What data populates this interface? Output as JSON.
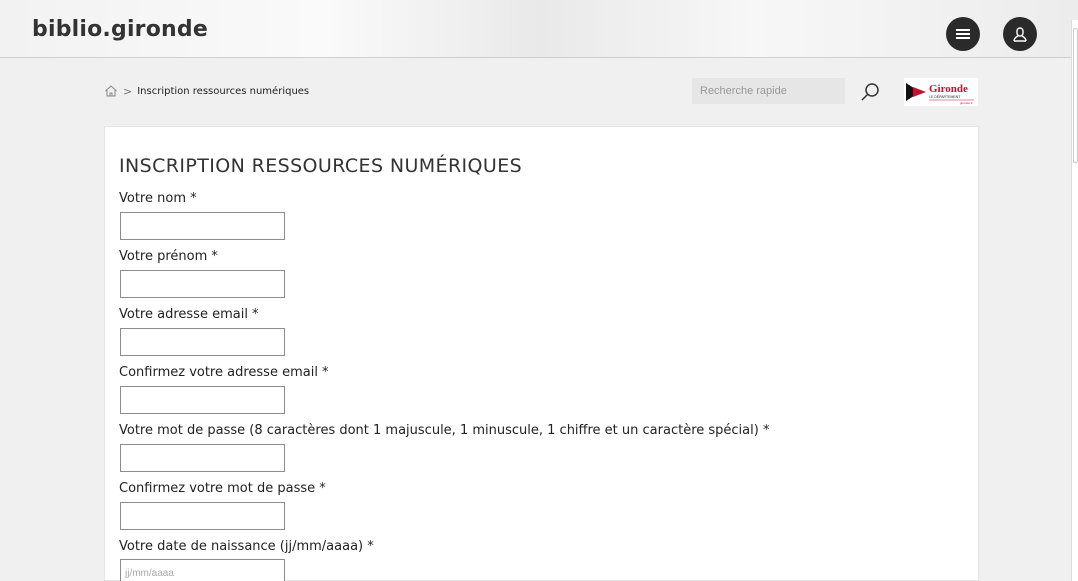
{
  "header": {
    "site_title": "biblio.gironde",
    "menu_icon": "hamburger-menu-icon",
    "user_icon": "user-account-icon"
  },
  "breadcrumb": {
    "home_icon": "home-icon",
    "separator": ">",
    "current": "Inscription ressources numériques"
  },
  "search": {
    "placeholder": "Recherche rapide",
    "icon": "search-icon"
  },
  "partner_logo": {
    "text": "Gironde",
    "subtext": "LE DÉPARTEMENT",
    "url_text": "gironde.fr"
  },
  "form": {
    "title": "INSCRIPTION RESSOURCES NUMÉRIQUES",
    "fields": [
      {
        "label": "Votre nom *",
        "value": "",
        "placeholder": ""
      },
      {
        "label": "Votre prénom *",
        "value": "",
        "placeholder": ""
      },
      {
        "label": "Votre adresse email *",
        "value": "",
        "placeholder": ""
      },
      {
        "label": "Confirmez votre adresse email *",
        "value": "",
        "placeholder": ""
      },
      {
        "label": "Votre mot de passe (8 caractères dont 1 majuscule, 1 minuscule, 1 chiffre et un caractère spécial) *",
        "value": "",
        "placeholder": ""
      },
      {
        "label": "Confirmez votre mot de passe *",
        "value": "",
        "placeholder": ""
      },
      {
        "label": "Votre date de naissance (jj/mm/aaaa) *",
        "value": "",
        "placeholder": "jj/mm/aaaa"
      }
    ]
  },
  "colors": {
    "header_bg": "#f2f2f2",
    "button_dark": "#2a2a2a",
    "brand_red": "#c8102e",
    "input_border": "#8c8c8c"
  }
}
